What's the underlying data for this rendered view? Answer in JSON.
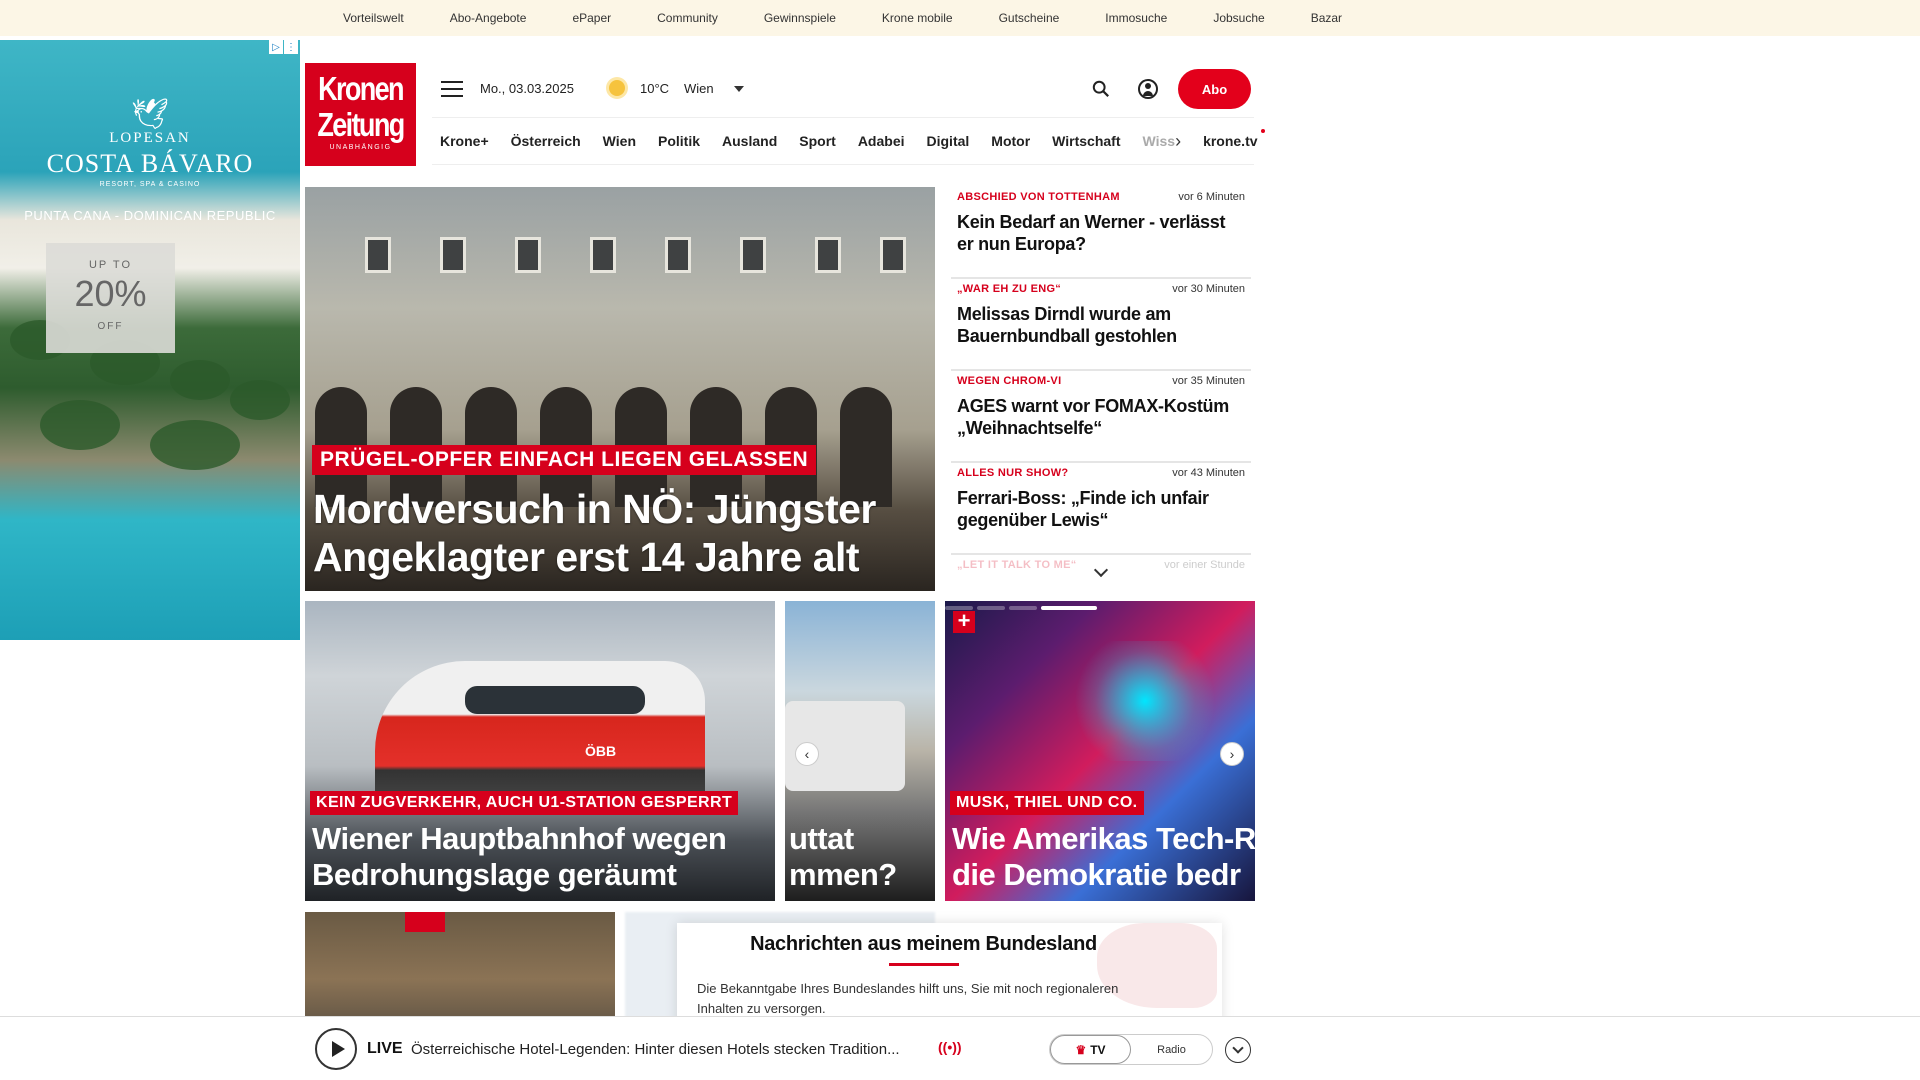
{
  "topbar": {
    "links": [
      "Vorteilswelt",
      "Abo-Angebote",
      "ePaper",
      "Community",
      "Gewinnspiele",
      "Krone mobile",
      "Gutscheine",
      "Immosuche",
      "Jobsuche",
      "Bazar"
    ]
  },
  "ad": {
    "brand_line1": "LOPESAN",
    "brand_line2": "COSTA BÁVARO",
    "brand_line3": "RESORT, SPA & CASINO",
    "location": "PUNTA CANA - DOMINICAN REPUBLIC",
    "promo_top": "UP TO",
    "promo_value": "20%",
    "promo_bottom": "OFF"
  },
  "logo": {
    "line1": "Kronen",
    "line2": "Zeitung",
    "subtitle": "UNABHÄNGIG"
  },
  "header": {
    "date": "Mo., 03.03.2025",
    "temperature": "10°C",
    "city": "Wien",
    "abo_label": "Abo"
  },
  "nav": {
    "items": [
      "Krone+",
      "Österreich",
      "Wien",
      "Politik",
      "Ausland",
      "Sport",
      "Adabei",
      "Digital",
      "Motor",
      "Wirtschaft"
    ],
    "truncated": "Wiss",
    "tv": "krone.tv"
  },
  "hero": {
    "kicker": "PRÜGEL-OPFER EINFACH LIEGEN GELASSEN",
    "headline": "Mordversuch in NÖ: Jüngster Angeklagter erst 14 Jahre alt"
  },
  "news": [
    {
      "kicker": "ABSCHIED VON TOTTENHAM",
      "time": "vor 6 Minuten",
      "title": "Kein Bedarf an Werner - verlässt er nun Europa?"
    },
    {
      "kicker": "„WAR EH ZU ENG“",
      "time": "vor 30 Minuten",
      "title": "Melissas Dirndl wurde am Bauernbundball gestohlen"
    },
    {
      "kicker": "WEGEN CHROM-VI",
      "time": "vor 35 Minuten",
      "title": "AGES warnt vor FOMAX-Kostüm „Weihnachtselfe“"
    },
    {
      "kicker": "ALLES NUR SHOW?",
      "time": "vor 43 Minuten",
      "title": "Ferrari-Boss: „Finde ich unfair gegenüber Lewis“"
    },
    {
      "kicker": "„LET IT TALK TO ME“",
      "time": "vor einer Stunde",
      "title": ""
    }
  ],
  "cards": [
    {
      "kicker": "KEIN ZUGVERKEHR, AUCH U1-STATION GESPERRT",
      "title": "Wiener Hauptbahnhof wegen Bedrohungslage geräumt",
      "badge": "ÖBB"
    },
    {
      "title_line1": "uttat",
      "title_line2": "mmen?"
    },
    {
      "kicker": "MUSK, THIEL UND CO.",
      "title_line1": "Wie Amerikas Tech-R",
      "title_line2": "die Demokratie bedr"
    }
  ],
  "modal": {
    "title": "Nachrichten aus meinem Bundesland",
    "text": "Die Bekanntgabe Ihres Bundeslandes hilft uns, Sie mit noch regionaleren Inhalten zu versorgen."
  },
  "player": {
    "live": "LIVE",
    "title": "Österreichische Hotel-Legenden: Hinter diesen Hotels stecken Tradition...",
    "tv": "TV",
    "radio": "Radio"
  }
}
